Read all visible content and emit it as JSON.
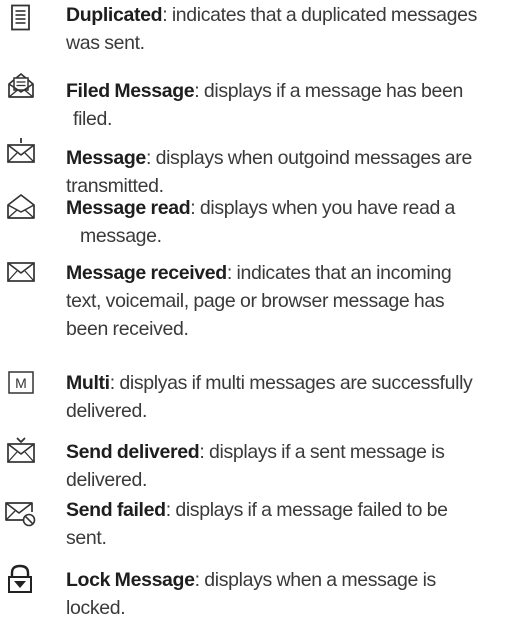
{
  "entries": [
    {
      "icon": "duplicated-message-icon",
      "term": "Duplicated",
      "line1": ": indicates that a duplicated messages",
      "line2": "was sent."
    },
    {
      "icon": "filed-message-icon",
      "term": "Filed Message",
      "line1": ": displays if a message has been",
      "line2": "filed."
    },
    {
      "icon": "outgoing-envelope-icon",
      "term": "Message",
      "line1": ": displays when outgoind messages are",
      "line2": "transmitted."
    },
    {
      "icon": "open-envelope-icon",
      "term": "Message read",
      "line1": ": displays when you have read a",
      "line2": "message."
    },
    {
      "icon": "envelope-icon",
      "term": "Message received",
      "line1": ": indicates that an incoming",
      "line2": "text, voicemail, page or browser message has",
      "line3": "been received."
    },
    {
      "icon": "multi-message-icon",
      "icon_letter": "M",
      "term": "Multi",
      "line1": ": displyas if multi messages are successfully",
      "line2": "delivered."
    },
    {
      "icon": "delivered-envelope-icon",
      "term": "Send delivered",
      "line1": ": displays if a sent message is",
      "line2": "delivered."
    },
    {
      "icon": "failed-envelope-icon",
      "term": "Send failed",
      "line1": ": displays if a message failed to be",
      "line2": "sent."
    },
    {
      "icon": "locked-message-icon",
      "term": "Lock Message",
      "line1": ": displays when a message is",
      "line2": "locked."
    }
  ]
}
